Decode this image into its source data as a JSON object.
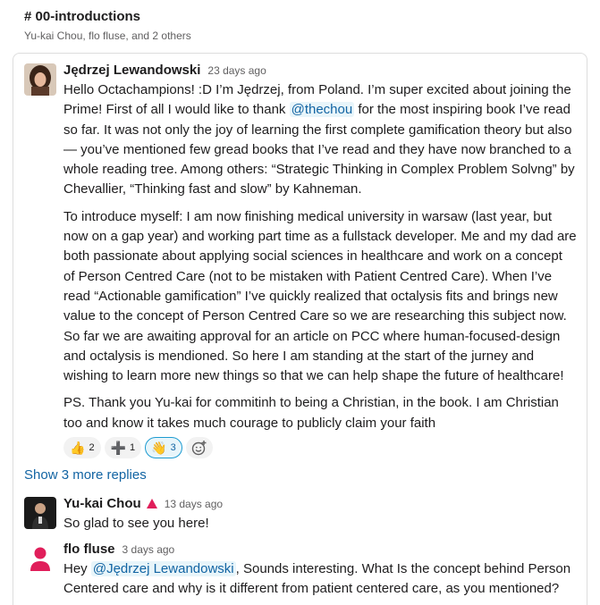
{
  "header": {
    "channel_title": "# 00-introductions",
    "members": "Yu-kai Chou, flo fluse, and 2 others"
  },
  "messages": [
    {
      "author": "Jędrzej Lewandowski",
      "time": "23 days ago",
      "avatar_icon": "user-photo-icon",
      "paragraphs": [
        {
          "before": "Hello Octachampions! :D I’m Jędrzej, from Poland. I’m super excited about joining the Prime! First of all I would like to thank ",
          "mention": "@thechou",
          "after": " for the most inspiring book I’ve read so far. It was not only the joy of learning the first complete gamification theory but also — you’ve mentioned few gread books that I’ve read and they have now branched to a whole reading tree. Among others: “Strategic Thinking in Complex Problem Solvng” by Chevallier, “Thinking fast and slow” by Kahneman."
        },
        {
          "text": "To introduce myself: I am now finishing medical university in warsaw (last year, but now on a gap year) and working part time as a fullstack developer. Me and my dad are both passionate about applying social sciences in healthcare and work on a concept of Person Centred Care (not to be mistaken with Patient Centred Care). When I’ve read “Actionable gamification” I’ve quickly realized that octalysis fits and brings new value to the concept of Person Centred Care so we are researching this subject now. So far we are awaiting approval for an article on PCC where human-focused-design and octalysis is mendioned. So here I am standing at the start of the jurney and wishing to learn more new things so that we can help shape the future of healthcare!"
        },
        {
          "text": "PS. Thank you Yu-kai for commitinh to being a Christian, in the book. I am Christian too and know it takes much courage to publicly claim your faith"
        }
      ],
      "reactions": [
        {
          "emoji": "👍",
          "count": "2",
          "active": false
        },
        {
          "emoji": "➕",
          "count": "1",
          "active": false
        },
        {
          "emoji": "👋",
          "count": "3",
          "active": true
        }
      ]
    },
    {
      "author": "Yu-kai Chou",
      "time": "13 days ago",
      "avatar_icon": "user-photo-icon",
      "badge_icon": "red-triangle-icon",
      "text": "So glad to see you here!"
    },
    {
      "author": "flo fluse",
      "time": "3 days ago",
      "avatar_icon": "default-person-icon",
      "before": "Hey ",
      "mention": "@Jędrzej Lewandowski",
      "after": ", Sounds interesting. What Is the concept behind Person Centered care and why is it different from patient centered care, as you mentioned?"
    }
  ],
  "show_more": "Show 3 more replies",
  "colors": {
    "link": "#1264a3",
    "mention_bg": "#e8f5fa",
    "default_avatar": "#e01e5a",
    "muted_text": "#616061"
  }
}
